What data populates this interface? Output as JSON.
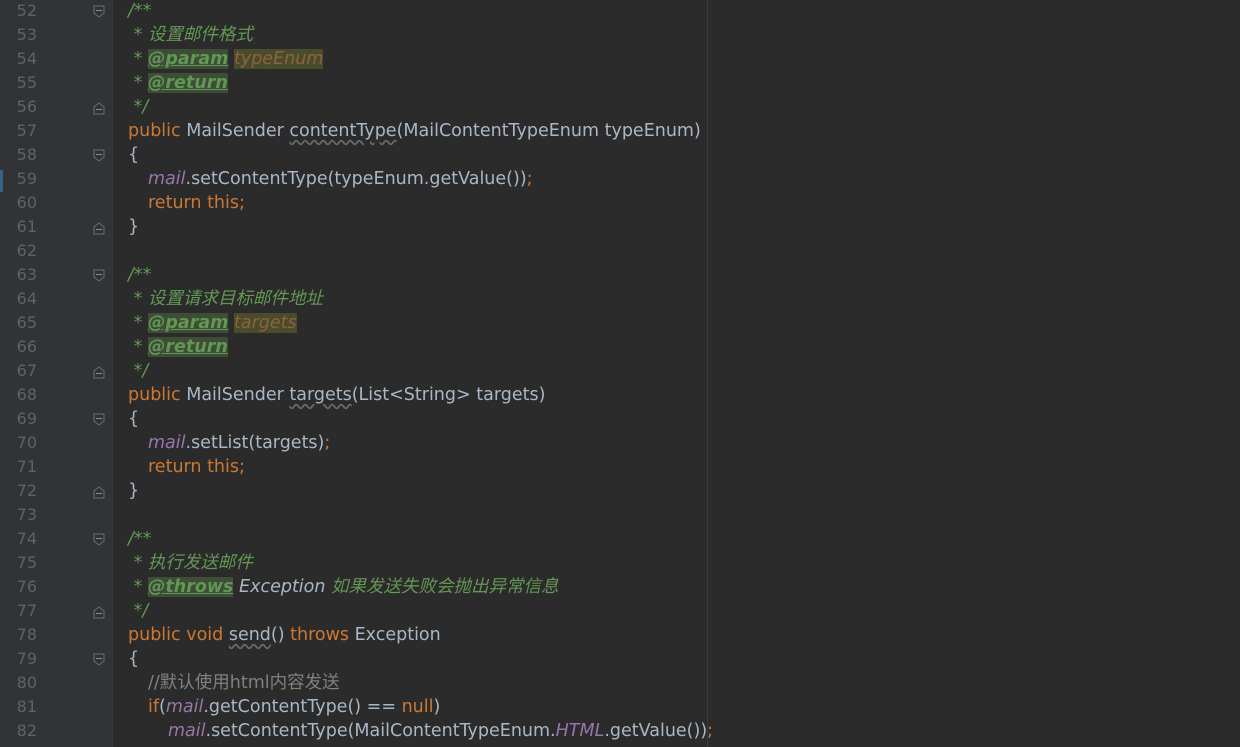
{
  "editor": {
    "lines": [
      {
        "n": "52",
        "fold": "start",
        "indent": 0,
        "tokens": [
          {
            "t": "/**",
            "c": "doc"
          }
        ]
      },
      {
        "n": "53",
        "indent": 0,
        "tokens": [
          {
            "t": " * 设置邮件格式",
            "c": "doc"
          }
        ]
      },
      {
        "n": "54",
        "indent": 0,
        "tokens": [
          {
            "t": " * ",
            "c": "doc"
          },
          {
            "t": "@param",
            "c": "tag"
          },
          {
            "t": " ",
            "c": "doc"
          },
          {
            "t": "typeEnum",
            "c": "pname"
          }
        ]
      },
      {
        "n": "55",
        "indent": 0,
        "tokens": [
          {
            "t": " * ",
            "c": "doc"
          },
          {
            "t": "@return",
            "c": "tag"
          }
        ]
      },
      {
        "n": "56",
        "fold": "end",
        "indent": 0,
        "tokens": [
          {
            "t": " */",
            "c": "doc"
          }
        ]
      },
      {
        "n": "57",
        "indent": 0,
        "tokens": [
          {
            "t": "public ",
            "c": "kw"
          },
          {
            "t": "MailSender ",
            "c": ""
          },
          {
            "t": "contentType",
            "c": "unused"
          },
          {
            "t": "(MailContentTypeEnum typeEnum)",
            "c": ""
          }
        ]
      },
      {
        "n": "58",
        "fold": "start",
        "indent": 0,
        "tokens": [
          {
            "t": "{",
            "c": ""
          }
        ]
      },
      {
        "n": "59",
        "indent": 1,
        "tokens": [
          {
            "t": "mail",
            "c": "field"
          },
          {
            "t": ".setContentType(typeEnum.getValue())",
            "c": ""
          },
          {
            "t": ";",
            "c": "kw"
          }
        ]
      },
      {
        "n": "60",
        "indent": 1,
        "tokens": [
          {
            "t": "return this;",
            "c": "kw"
          }
        ]
      },
      {
        "n": "61",
        "fold": "end",
        "indent": 0,
        "tokens": [
          {
            "t": "}",
            "c": ""
          }
        ]
      },
      {
        "n": "62",
        "indent": 0,
        "tokens": []
      },
      {
        "n": "63",
        "fold": "start",
        "indent": 0,
        "tokens": [
          {
            "t": "/**",
            "c": "doc"
          }
        ]
      },
      {
        "n": "64",
        "indent": 0,
        "tokens": [
          {
            "t": " * 设置请求目标邮件地址",
            "c": "doc"
          }
        ]
      },
      {
        "n": "65",
        "indent": 0,
        "tokens": [
          {
            "t": " * ",
            "c": "doc"
          },
          {
            "t": "@param",
            "c": "tag"
          },
          {
            "t": " ",
            "c": "doc"
          },
          {
            "t": "targets",
            "c": "pname"
          }
        ]
      },
      {
        "n": "66",
        "indent": 0,
        "tokens": [
          {
            "t": " * ",
            "c": "doc"
          },
          {
            "t": "@return",
            "c": "tag"
          }
        ]
      },
      {
        "n": "67",
        "fold": "end",
        "indent": 0,
        "tokens": [
          {
            "t": " */",
            "c": "doc"
          }
        ]
      },
      {
        "n": "68",
        "indent": 0,
        "tokens": [
          {
            "t": "public ",
            "c": "kw"
          },
          {
            "t": "MailSender ",
            "c": ""
          },
          {
            "t": "targets",
            "c": "unused"
          },
          {
            "t": "(List<String> targets)",
            "c": ""
          }
        ]
      },
      {
        "n": "69",
        "fold": "start",
        "indent": 0,
        "tokens": [
          {
            "t": "{",
            "c": ""
          }
        ]
      },
      {
        "n": "70",
        "indent": 1,
        "tokens": [
          {
            "t": "mail",
            "c": "field"
          },
          {
            "t": ".setList(targets)",
            "c": ""
          },
          {
            "t": ";",
            "c": "kw"
          }
        ]
      },
      {
        "n": "71",
        "indent": 1,
        "tokens": [
          {
            "t": "return this;",
            "c": "kw"
          }
        ]
      },
      {
        "n": "72",
        "fold": "end",
        "indent": 0,
        "tokens": [
          {
            "t": "}",
            "c": ""
          }
        ]
      },
      {
        "n": "73",
        "indent": 0,
        "tokens": []
      },
      {
        "n": "74",
        "fold": "start",
        "indent": 0,
        "tokens": [
          {
            "t": "/**",
            "c": "doc"
          }
        ]
      },
      {
        "n": "75",
        "indent": 0,
        "tokens": [
          {
            "t": " * 执行发送邮件",
            "c": "doc"
          }
        ]
      },
      {
        "n": "76",
        "indent": 0,
        "tokens": [
          {
            "t": " * ",
            "c": "doc"
          },
          {
            "t": "@throws",
            "c": "tag"
          },
          {
            "t": " ",
            "c": "doc"
          },
          {
            "t": "Exception",
            "c": "ref"
          },
          {
            "t": " 如果发送失败会抛出异常信息",
            "c": "doc"
          }
        ]
      },
      {
        "n": "77",
        "fold": "end",
        "indent": 0,
        "tokens": [
          {
            "t": " */",
            "c": "doc"
          }
        ]
      },
      {
        "n": "78",
        "indent": 0,
        "tokens": [
          {
            "t": "public void ",
            "c": "kw"
          },
          {
            "t": "send",
            "c": "unused"
          },
          {
            "t": "() ",
            "c": ""
          },
          {
            "t": "throws ",
            "c": "kw"
          },
          {
            "t": "Exception",
            "c": ""
          }
        ]
      },
      {
        "n": "79",
        "fold": "start",
        "indent": 0,
        "tokens": [
          {
            "t": "{",
            "c": ""
          }
        ]
      },
      {
        "n": "80",
        "indent": 1,
        "tokens": [
          {
            "t": "//默认使用html内容发送",
            "c": "cmt"
          }
        ]
      },
      {
        "n": "81",
        "indent": 1,
        "tokens": [
          {
            "t": "if",
            "c": "kw"
          },
          {
            "t": "(",
            "c": ""
          },
          {
            "t": "mail",
            "c": "field"
          },
          {
            "t": ".getContentType() == ",
            "c": ""
          },
          {
            "t": "null",
            "c": "kw"
          },
          {
            "t": ")",
            "c": ""
          }
        ]
      },
      {
        "n": "82",
        "indent": 2,
        "tokens": [
          {
            "t": "mail",
            "c": "field"
          },
          {
            "t": ".setContentType(MailContentTypeEnum.",
            "c": ""
          },
          {
            "t": "HTML",
            "c": "cst"
          },
          {
            "t": ".getValue())",
            "c": ""
          },
          {
            "t": ";",
            "c": "kw"
          }
        ]
      }
    ]
  }
}
